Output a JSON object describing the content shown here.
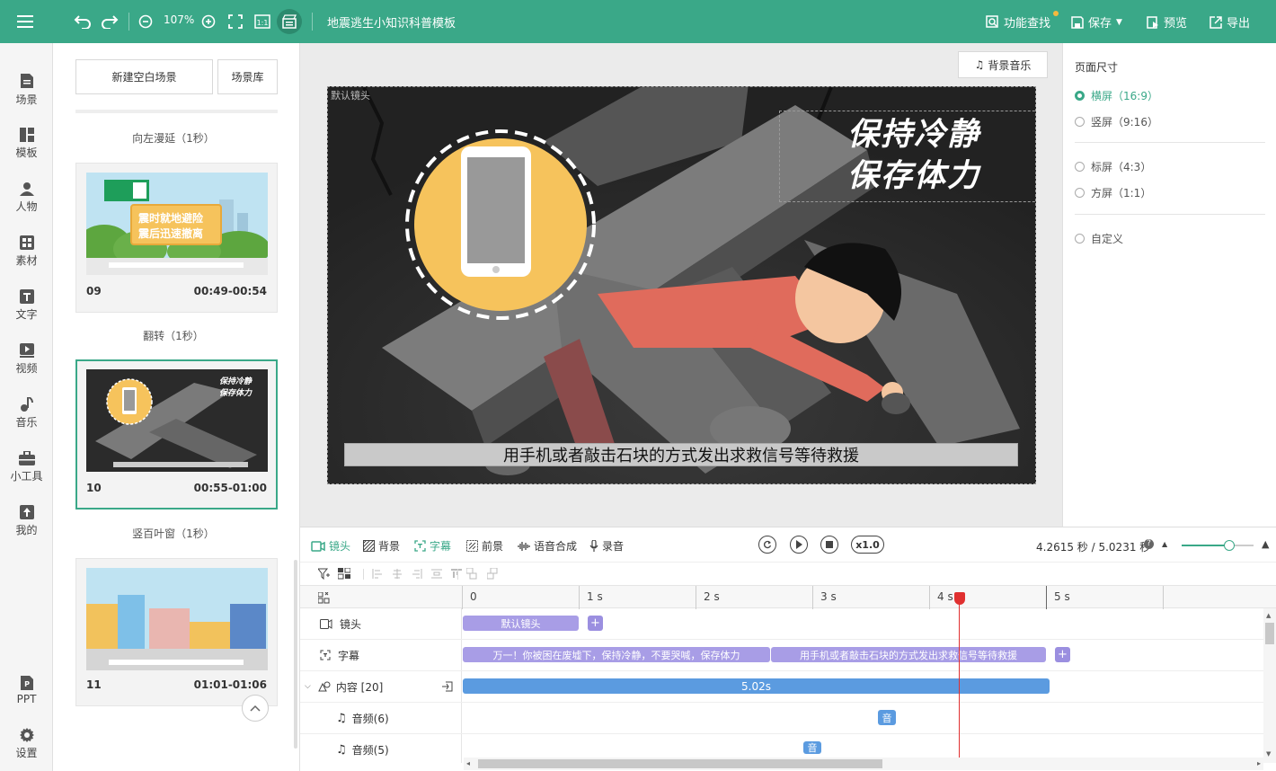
{
  "app": {
    "title": "地震逃生小知识科普模板",
    "zoom": "107%",
    "actions": {
      "search": "功能查找",
      "save": "保存",
      "preview": "预览",
      "export": "导出"
    }
  },
  "nav": [
    {
      "label": "场景",
      "icon": "scene-icon"
    },
    {
      "label": "模板",
      "icon": "template-icon"
    },
    {
      "label": "人物",
      "icon": "person-icon"
    },
    {
      "label": "素材",
      "icon": "material-icon"
    },
    {
      "label": "文字",
      "icon": "text-icon"
    },
    {
      "label": "视频",
      "icon": "video-icon"
    },
    {
      "label": "音乐",
      "icon": "music-icon"
    },
    {
      "label": "小工具",
      "icon": "toolbox-icon"
    },
    {
      "label": "我的",
      "icon": "upload-icon"
    },
    {
      "label": "PPT",
      "icon": "ppt-icon"
    },
    {
      "label": "设置",
      "icon": "gear-icon"
    }
  ],
  "scenes": {
    "new_blank": "新建空白场景",
    "library": "场景库",
    "transitions": [
      "向左漫延（1秒）",
      "翻转（1秒）",
      "竖百叶窗（1秒）"
    ],
    "cards": [
      {
        "num": "09",
        "time": "00:49-00:54",
        "sign1": "震时就地避险",
        "sign2": "震后迅速撤离"
      },
      {
        "num": "10",
        "time": "00:55-01:00",
        "title1": "保持冷静",
        "title2": "保存体力"
      },
      {
        "num": "11",
        "time": "01:01-01:06"
      }
    ]
  },
  "canvas": {
    "bg_music": "背景音乐",
    "camera_label": "默认镜头",
    "title_line1": "保持冷静",
    "title_line2": "保存体力",
    "subtitle": "用手机或者敲击石块的方式发出求救信号等待救援"
  },
  "page_size": {
    "title": "页面尺寸",
    "options": [
      "横屏（16:9）",
      "竖屏（9:16）",
      "标屏（4:3）",
      "方屏（1:1）",
      "自定义"
    ],
    "selected": 0
  },
  "timeline": {
    "tools": [
      "镜头",
      "背景",
      "字幕",
      "前景",
      "语音合成",
      "录音"
    ],
    "speed": "x1.0",
    "time_display": "4.2615 秒 / 5.0231 秒",
    "playhead_seconds": 4.2615,
    "zoom_fraction": 0.66,
    "ruler": [
      "0",
      "1 s",
      "2 s",
      "3 s",
      "4 s",
      "5 s"
    ],
    "tracks": {
      "camera": "镜头",
      "subtitle": "字幕",
      "content": "内容 [20]",
      "audio6": "音频(6)",
      "audio5": "音频(5)"
    },
    "clips": {
      "camera": "默认镜头",
      "sub1": "万一！你被困在废墟下，保持冷静，不要哭喊，保存体力",
      "sub2": "用手机或者敲击石块的方式发出求救信号等待救援",
      "content": "5.02s",
      "audio": "音"
    }
  },
  "colors": {
    "accent": "#3aa888",
    "clip_purple": "#a89de6",
    "clip_blue": "#5b9be0",
    "playhead": "#e03030"
  }
}
